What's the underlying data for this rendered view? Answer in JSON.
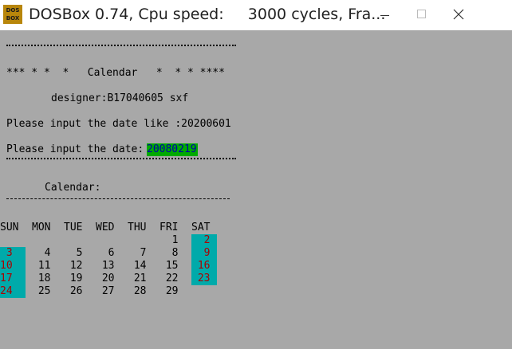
{
  "window": {
    "title": "DOSBox 0.74, Cpu speed:     3000 cycles, Fra...",
    "logo_top": "DOS",
    "logo_bottom": "BOX"
  },
  "console": {
    "banner_line": "*** * *  *   Calendar   *  * * ****",
    "designer_line": "designer:B17040605 sxf",
    "format_line": "Please input the date like :20200601",
    "prompt_line": "Please input the date:",
    "input_value": "20080219",
    "calendar_label": "Calendar:"
  },
  "calendar": {
    "weekdays": [
      "SUN",
      "MON",
      "TUE",
      "WED",
      "THU",
      "FRI",
      "SAT"
    ],
    "weeks": [
      [
        "",
        "",
        "",
        "",
        "",
        "1",
        "2"
      ],
      [
        "3",
        "4",
        "5",
        "6",
        "7",
        "8",
        "9"
      ],
      [
        "10",
        "11",
        "12",
        "13",
        "14",
        "15",
        "16"
      ],
      [
        "17",
        "18",
        "19",
        "20",
        "21",
        "22",
        "23"
      ],
      [
        "24",
        "25",
        "26",
        "27",
        "28",
        "29",
        ""
      ]
    ],
    "weekend_highlight": "#00aaaa",
    "weekend_text": "#aa0000",
    "input_highlight": "#00aa00",
    "input_text": "#0000aa"
  }
}
